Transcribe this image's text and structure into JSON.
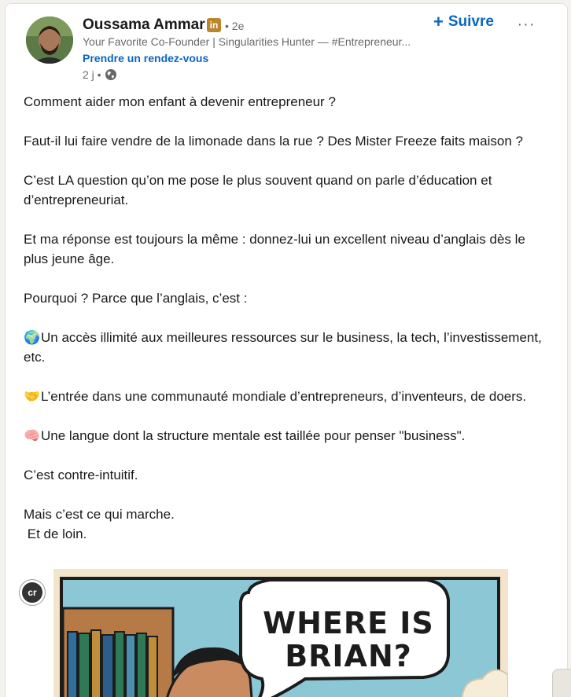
{
  "author": {
    "name": "Oussama Ammar",
    "badge": "in",
    "degree": "• 2e",
    "headline": "Your Favorite Co-Founder | Singularities Hunter — #Entrepreneur...",
    "cta": "Prendre un rendez-vous",
    "time": "2 j •"
  },
  "actions": {
    "follow_label": "Suivre",
    "follow_icon": "plus-icon",
    "more_label": "···"
  },
  "post": {
    "p1": "Comment aider mon enfant à devenir entrepreneur ?",
    "p2": "Faut-il lui faire vendre de la limonade dans la rue ? Des Mister Freeze faits maison ?",
    "p3": "C’est LA question qu’on me pose le plus souvent quand on parle d’éducation et d’entrepreneuriat.",
    "p4": "Et ma réponse est toujours la même : donnez-lui un excellent niveau d’anglais dès le plus jeune âge.",
    "p5": "Pourquoi ? Parce que l’anglais, c’est :",
    "p6_emoji": "🌍",
    "p6": "Un accès illimité aux meilleures ressources sur le business, la tech, l’investissement, etc.",
    "p7_emoji": "🤝",
    "p7": "L’entrée dans une communauté mondiale d’entrepreneurs, d’inventeurs, de doers.",
    "p8_emoji": "🧠",
    "p8": "Une langue dont la structure mentale est taillée pour penser \"business\".",
    "p9": "C’est contre-intuitif.",
    "p10": "Mais c’est ce qui marche.",
    "p11": "Et de loin."
  },
  "image": {
    "bubble_text_line1": "WHERE IS",
    "bubble_text_line2": "BRIAN?",
    "badge": "cr"
  },
  "colors": {
    "accent": "#0a66c2",
    "badge_gold": "#b9862b",
    "comic_sky": "#8cc7d6",
    "comic_bg": "#f3e4cc"
  }
}
